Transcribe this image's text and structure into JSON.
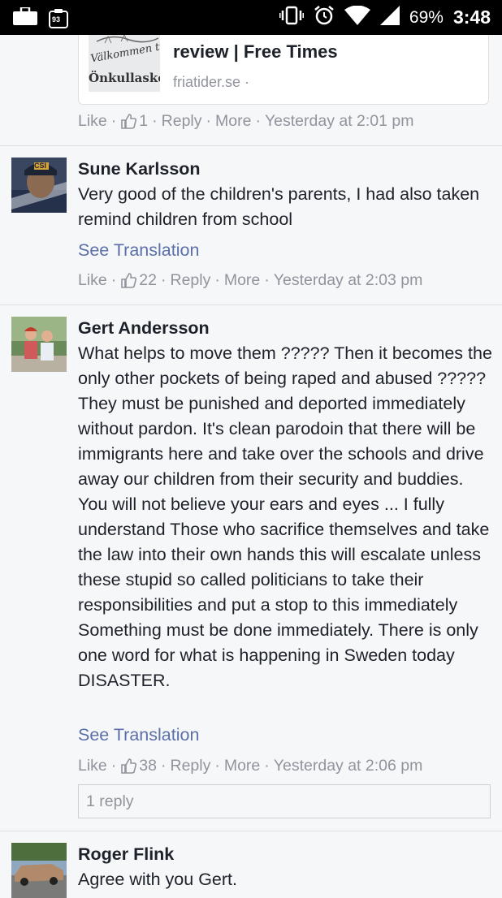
{
  "status_bar": {
    "notification_badge": "93",
    "battery": "69%",
    "time": "3:48"
  },
  "link_preview": {
    "thumb_text_1": "Välkommen till",
    "thumb_text_2": "Önkullaskolan",
    "title": "review | Free Times",
    "domain": "friatider.se ·"
  },
  "first_meta": {
    "like": "Like",
    "likes": "1",
    "reply": "Reply",
    "more": "More",
    "time": "Yesterday at 2:01 pm"
  },
  "comments": [
    {
      "author": "Sune Karlsson",
      "text": "Very good of the children's parents, I had also taken remind children from school",
      "see_translation": "See Translation",
      "like": "Like",
      "likes": "22",
      "reply": "Reply",
      "more": "More",
      "time": "Yesterday at 2:03 pm",
      "avatar_text": "CSI"
    },
    {
      "author": "Gert Andersson",
      "text": "What helps to move them ????? Then it becomes the only other pockets of being raped and abused ????? They must be punished and deported immediately without pardon. It's clean parodoin that there will be immigrants here and take over the schools and drive away our children from their security and buddies. You will not believe your ears and eyes ... I fully understand Those who sacrifice themselves and take the law into their own hands this will escalate unless these stupid so called politicians to take their responsibilities and put a stop to this immediately Something must be done immediately. There is only one word for what is happening in Sweden today DISASTER.",
      "see_translation": "See Translation",
      "like": "Like",
      "likes": "38",
      "reply": "Reply",
      "more": "More",
      "time": "Yesterday at 2:06 pm",
      "replies_label": "1 reply"
    },
    {
      "author": "Roger Flink",
      "text": "Agree with you Gert."
    }
  ],
  "colors": {
    "link_blue": "#5b6fa8",
    "meta_gray": "#90949c",
    "text": "#1d2129",
    "background": "#f6f7f9"
  }
}
